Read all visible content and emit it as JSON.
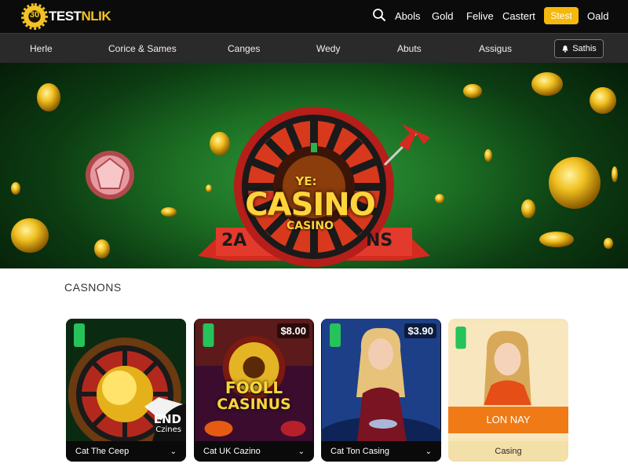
{
  "brand": {
    "mark": "30",
    "name_a": "TEST",
    "name_b": "NLIK"
  },
  "topnav": {
    "links": [
      "Abols",
      "Gold",
      "Felive",
      "Castert"
    ],
    "cta_label": "Stest",
    "last_link": "Oald"
  },
  "nav": {
    "items": [
      "Herle",
      "Corice & Sames",
      "Canges",
      "Wedy",
      "Abuts",
      "Assigus"
    ],
    "button_label": "Sathis"
  },
  "hero": {
    "small": "YE:",
    "title": "CASINO",
    "subtitle": "CASINO",
    "ribbon_left": "2A",
    "ribbon_right": "NS"
  },
  "section": {
    "title": "CASNONS"
  },
  "cards": [
    {
      "label": "Cat The Ceep",
      "overlay_a": "END",
      "overlay_b": "Czines"
    },
    {
      "label": "Cat UK Cazino",
      "price": "$8.00",
      "art_a": "FOOLL",
      "art_b": "CASINUS"
    },
    {
      "label": "Cat Ton Casing",
      "price": "$3.90"
    },
    {
      "label": "Casing",
      "banner": "LON NAY"
    }
  ],
  "colors": {
    "accent": "#f5b80c",
    "brand": "#f3c326",
    "hero_green": "#1c6e23",
    "badge": "#26c25a"
  }
}
